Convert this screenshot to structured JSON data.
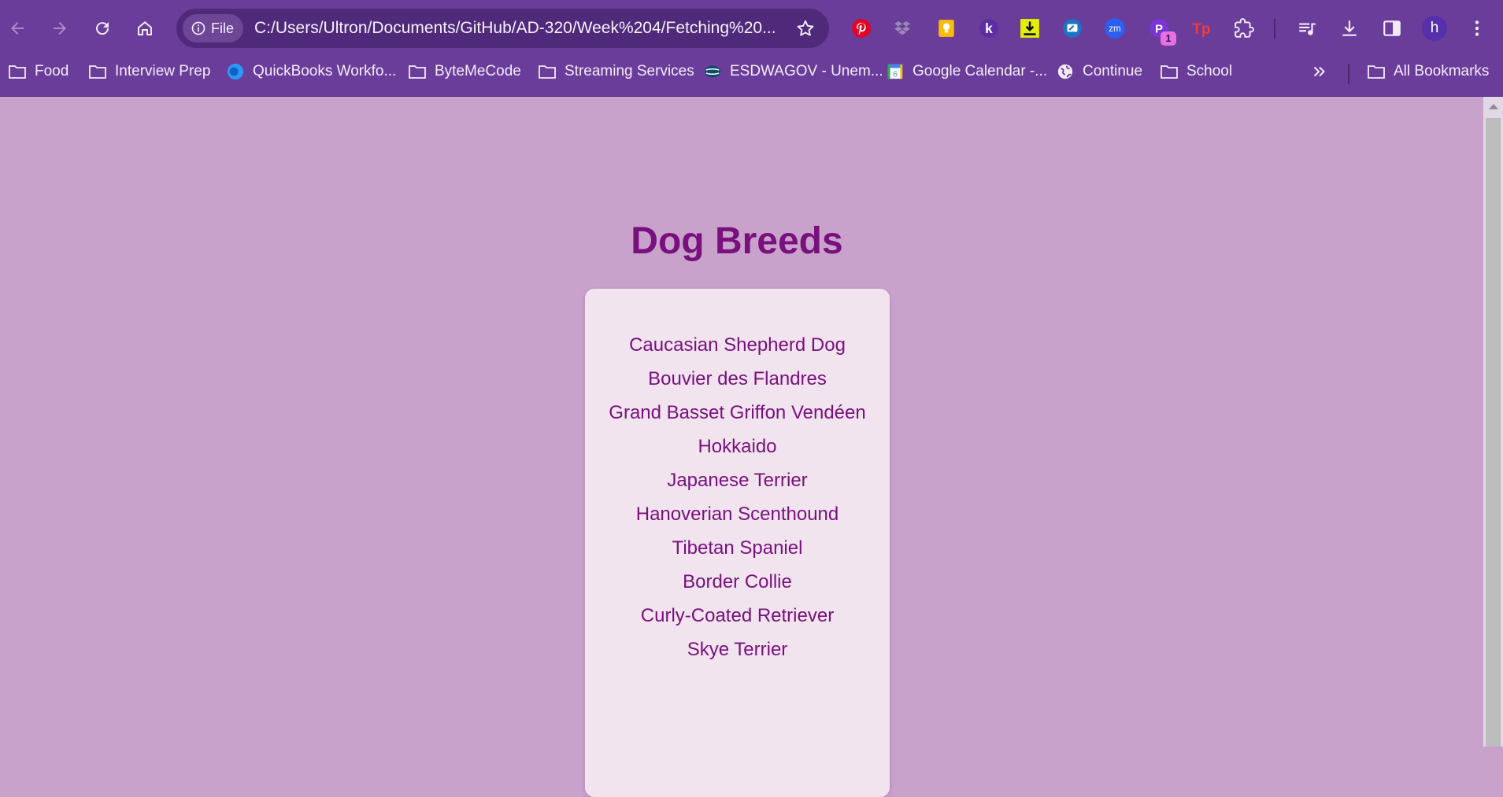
{
  "browser": {
    "site_chip_label": "File",
    "url": "C:/Users/Ultron/Documents/GitHub/AD-320/Week%204/Fetching%20...",
    "profile_initial": "h",
    "extension_badge": "1",
    "colors": {
      "chrome": "#6a3d9a",
      "omnibox": "#4f2a7a"
    }
  },
  "bookmarks": [
    {
      "label": "Food",
      "icon": "folder-icon"
    },
    {
      "label": "Interview Prep",
      "icon": "folder-icon"
    },
    {
      "label": "QuickBooks Workfo...",
      "icon": "quickbooks-icon"
    },
    {
      "label": "ByteMeCode",
      "icon": "folder-icon"
    },
    {
      "label": "Streaming Services",
      "icon": "folder-icon"
    },
    {
      "label": "ESDWAGOV - Unem...",
      "icon": "esd-icon"
    },
    {
      "label": "Google Calendar -...",
      "icon": "calendar-icon"
    },
    {
      "label": "Continue",
      "icon": "globe-icon"
    },
    {
      "label": "School",
      "icon": "folder-icon"
    }
  ],
  "all_bookmarks_label": "All Bookmarks",
  "page": {
    "title": "Dog Breeds",
    "breeds": [
      "Caucasian Shepherd Dog",
      "Bouvier des Flandres",
      "Grand Basset Griffon Vendéen",
      "Hokkaido",
      "Japanese Terrier",
      "Hanoverian Scenthound",
      "Tibetan Spaniel",
      "Border Collie",
      "Curly-Coated Retriever",
      "Skye Terrier"
    ],
    "colors": {
      "background": "#c8a2cb",
      "card": "#f1e4ef",
      "text": "#7a0f7e"
    }
  }
}
